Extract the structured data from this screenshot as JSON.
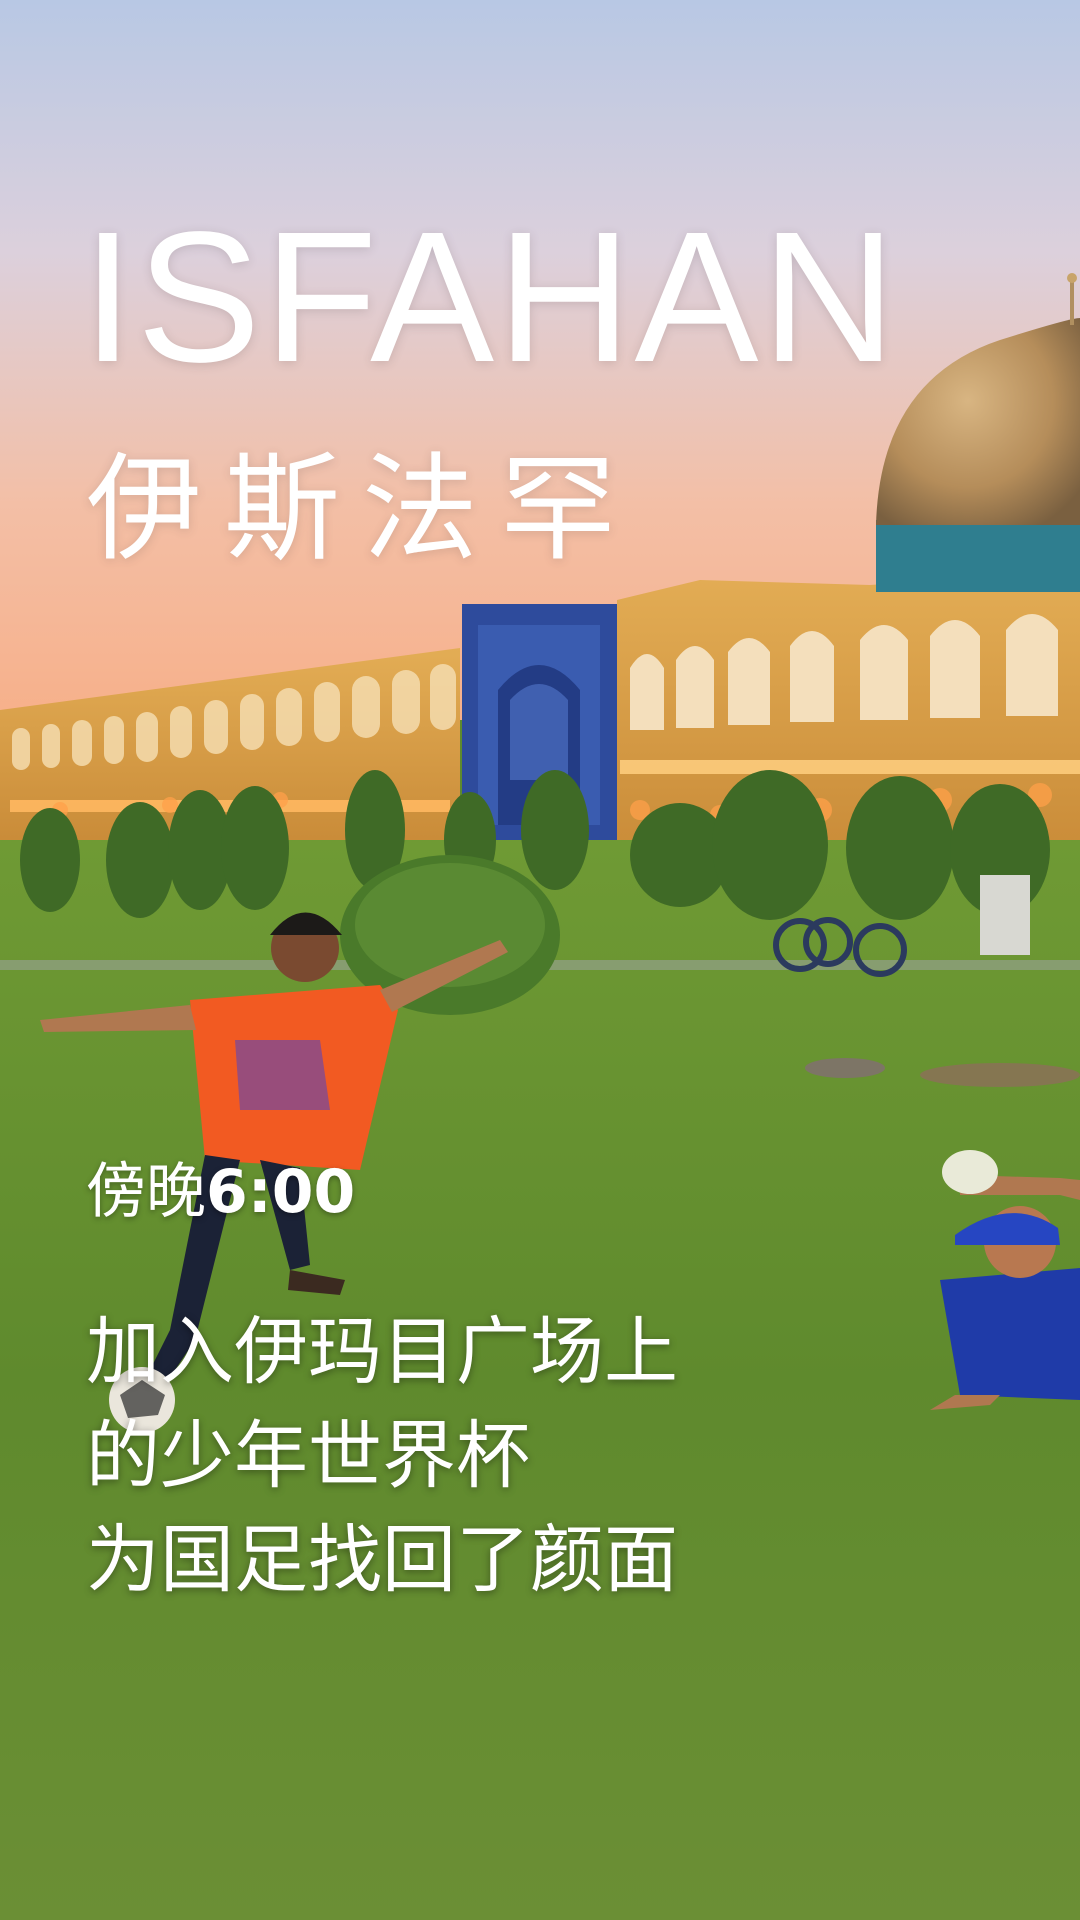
{
  "title_en": "ISFAHAN",
  "title_cn": "伊斯法罕",
  "time": {
    "prefix": "傍晚",
    "value": "6:00"
  },
  "caption_lines": [
    "加入伊玛目广场上",
    "的少年世界杯",
    "为国足找回了颜面"
  ],
  "colors": {
    "text": "#ffffff",
    "sky_top": "#b9c9e3",
    "sky_bottom": "#f0b393",
    "grass": "#5e8a2e",
    "arcade_yellow": "#d9a24a",
    "tile_blue": "#2f4fa0"
  }
}
